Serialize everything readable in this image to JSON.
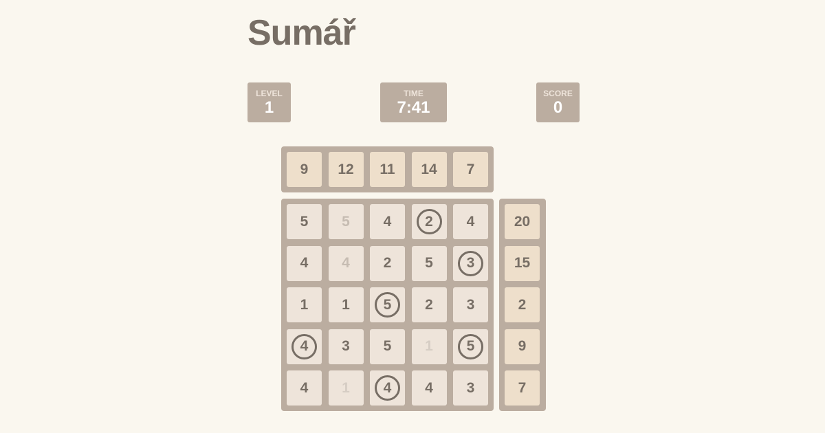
{
  "title": "Sumář",
  "stats": {
    "level": {
      "label": "LEVEL",
      "value": "1"
    },
    "time": {
      "label": "TIME",
      "value": "7:41"
    },
    "score": {
      "label": "SCORE",
      "value": "0"
    }
  },
  "column_targets": [
    "9",
    "12",
    "11",
    "14",
    "7"
  ],
  "row_targets": [
    "20",
    "15",
    "2",
    "9",
    "7"
  ],
  "grid": [
    [
      {
        "v": "5",
        "state": "normal"
      },
      {
        "v": "5",
        "state": "removed"
      },
      {
        "v": "4",
        "state": "normal"
      },
      {
        "v": "2",
        "state": "circled"
      },
      {
        "v": "4",
        "state": "normal"
      }
    ],
    [
      {
        "v": "4",
        "state": "normal"
      },
      {
        "v": "4",
        "state": "removed"
      },
      {
        "v": "2",
        "state": "normal"
      },
      {
        "v": "5",
        "state": "normal"
      },
      {
        "v": "3",
        "state": "circled"
      }
    ],
    [
      {
        "v": "1",
        "state": "normal"
      },
      {
        "v": "1",
        "state": "normal"
      },
      {
        "v": "5",
        "state": "circled"
      },
      {
        "v": "2",
        "state": "normal"
      },
      {
        "v": "3",
        "state": "normal"
      }
    ],
    [
      {
        "v": "4",
        "state": "circled"
      },
      {
        "v": "3",
        "state": "normal"
      },
      {
        "v": "5",
        "state": "normal"
      },
      {
        "v": "1",
        "state": "removed-light"
      },
      {
        "v": "5",
        "state": "circled"
      }
    ],
    [
      {
        "v": "4",
        "state": "normal"
      },
      {
        "v": "1",
        "state": "removed-light"
      },
      {
        "v": "4",
        "state": "circled"
      },
      {
        "v": "4",
        "state": "normal"
      },
      {
        "v": "3",
        "state": "normal"
      }
    ]
  ],
  "colors": {
    "background": "#faf7ef",
    "panel": "#bbada0",
    "cell": "#eee4da",
    "target_cell": "#eedfcb",
    "text": "#776e65",
    "removed_text": "#c6bcb2"
  }
}
